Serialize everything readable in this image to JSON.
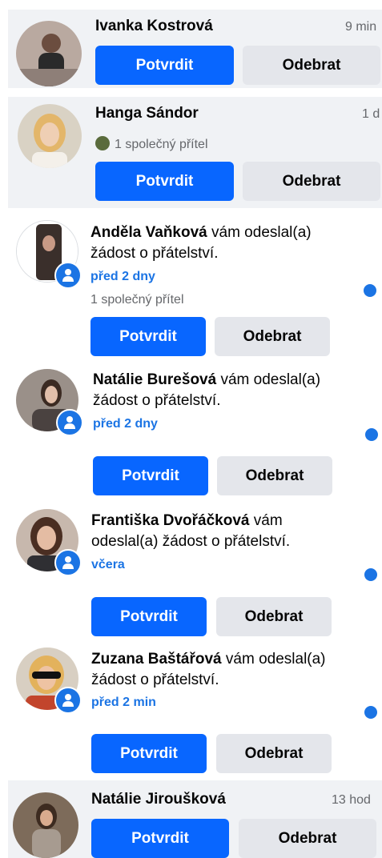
{
  "requests": [
    {
      "name": "Ivanka Kostrová",
      "time": "9 min",
      "confirm": "Potvrdit",
      "remove": "Odebrat"
    },
    {
      "name": "Hanga Sándor",
      "time": "1 d",
      "mutual": "1 společný přítel",
      "confirm": "Potvrdit",
      "remove": "Odebrat"
    },
    {
      "name": "Anděla Vaňková",
      "msg": " vám odeslal(a) žádost o přátelství.",
      "ago": "před 2 dny",
      "mutual": "1 společný přítel",
      "confirm": "Potvrdit",
      "remove": "Odebrat"
    },
    {
      "name": "Natálie Burešová",
      "msg": " vám odeslal(a) žádost o přátelství.",
      "ago": "před 2 dny",
      "confirm": "Potvrdit",
      "remove": "Odebrat"
    },
    {
      "name": "Františka Dvořáčková",
      "msg": " vám odeslal(a) žádost o přátelství.",
      "ago": "včera",
      "confirm": "Potvrdit",
      "remove": "Odebrat"
    },
    {
      "name": "Zuzana Baštářová",
      "msg": " vám odeslal(a) žádost o přátelství.",
      "ago": "před 2 min",
      "confirm": "Potvrdit",
      "remove": "Odebrat"
    },
    {
      "name": "Natálie Jiroušková",
      "time": "13 hod",
      "confirm": "Potvrdit",
      "remove": "Odebrat"
    }
  ],
  "colors": {
    "primary": "#0866ff",
    "secondary": "#e4e6eb",
    "highlight": "#f0f2f5",
    "link": "#1b74e4"
  },
  "icons": {
    "badge": "friend-request-person-icon",
    "unread": "unread-dot-icon"
  }
}
